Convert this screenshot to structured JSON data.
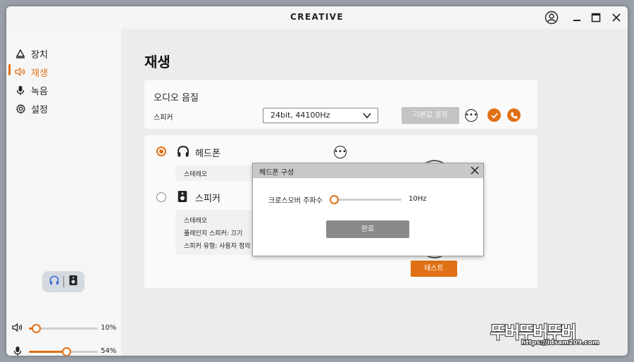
{
  "window": {
    "brand": "CREATIVE"
  },
  "sidebar": {
    "items": [
      {
        "label": "장치",
        "icon": "device-icon"
      },
      {
        "label": "재생",
        "icon": "speaker-icon",
        "active": true
      },
      {
        "label": "녹음",
        "icon": "microphone-icon"
      },
      {
        "label": "설정",
        "icon": "gear-icon"
      }
    ],
    "output_toggle": [
      "headphones-icon",
      "speaker-box-icon"
    ],
    "volume": {
      "label": "10%",
      "value": 10
    },
    "mic": {
      "label": "54%",
      "value": 54
    }
  },
  "main": {
    "title": "재생",
    "audio_quality": {
      "title": "오디오 음질",
      "device_label": "스피커",
      "format": "24bit, 44100Hz",
      "default_button": "기본값 설정"
    },
    "outputs": {
      "headphone": {
        "label": "헤드폰",
        "selected": true,
        "details": [
          "스테레오"
        ]
      },
      "speaker": {
        "label": "스피커",
        "selected": false,
        "details": [
          "스테레오",
          "풀레인지 스피커: 끄기",
          "스피커 유형: 사용자 정의"
        ]
      },
      "test_button": "테스트"
    }
  },
  "dialog": {
    "title": "헤드폰 구성",
    "crossover_label": "크로스오버 주파수",
    "crossover_value": "10Hz",
    "crossover_level": 0,
    "done_button": "완료"
  },
  "watermark": {
    "text": "뚜버뚜버뚜버",
    "url": "https://idsam209.com"
  },
  "colors": {
    "accent": "#e07014",
    "card": "#fafafa",
    "background": "#ececec"
  }
}
